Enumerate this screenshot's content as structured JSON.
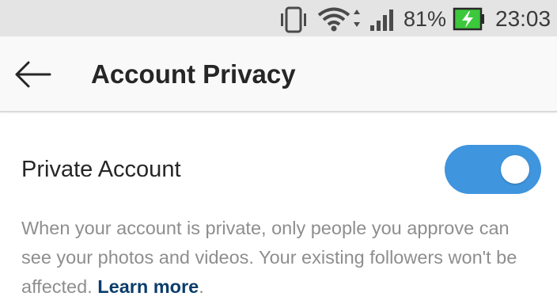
{
  "status_bar": {
    "icons": [
      "vibrate-icon",
      "wifi-icon",
      "signal-icon",
      "battery-charging-icon"
    ],
    "battery_percent": "81%",
    "time": "23:03",
    "battery_color": "#3cc83c"
  },
  "app_bar": {
    "back_icon": "arrow-left-icon",
    "title": "Account Privacy"
  },
  "settings": {
    "private_account": {
      "label": "Private Account",
      "enabled": true,
      "toggle_color": "#3f95de"
    },
    "description": {
      "text": "When your account is private, only people you approve can see your photos and videos. Your existing followers won't be affected.",
      "link_text": "Learn more",
      "trailing": "."
    }
  }
}
